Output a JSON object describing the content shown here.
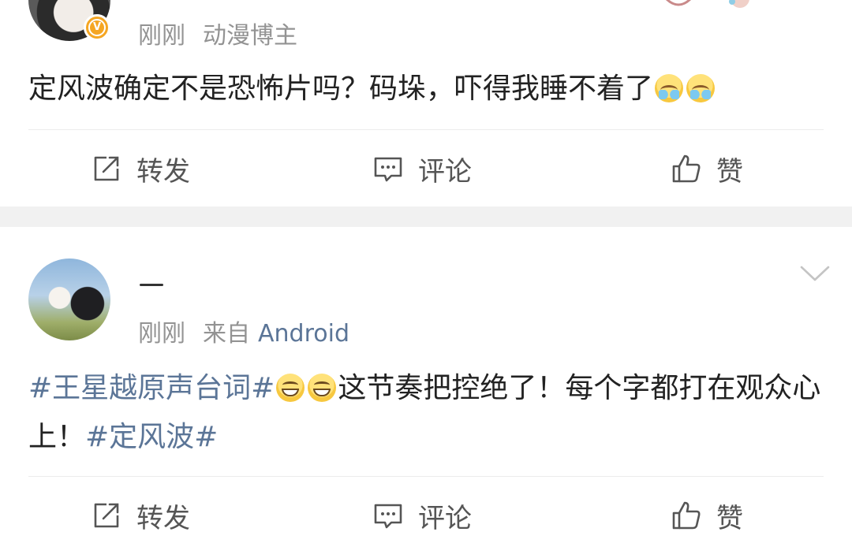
{
  "posts": [
    {
      "time": "刚刚",
      "source": "动漫博主",
      "verified": true,
      "content_text": "定风波确定不是恐怖片吗？码垛，吓得我睡不着了",
      "trailing_emojis": [
        "cry-emoji",
        "cry-emoji"
      ],
      "actions": {
        "repost_label": "转发",
        "comment_label": "评论",
        "like_label": "赞"
      }
    },
    {
      "time": "刚刚",
      "source_prefix": "来自",
      "source": "Android",
      "content": {
        "hashtag_1": "#王星越原声台词#",
        "emojis": [
          "grin-emoji",
          "grin-emoji"
        ],
        "text": "这节奏把控绝了！每个字都打在观众心上！",
        "hashtag_2": "#定风波#"
      },
      "actions": {
        "repost_label": "转发",
        "comment_label": "评论",
        "like_label": "赞"
      }
    }
  ],
  "icons": {
    "repost": "repost-icon",
    "comment": "comment-icon",
    "like": "thumbs-up-icon",
    "more": "chevron-down-icon",
    "verified": "verified-badge-icon"
  },
  "colors": {
    "hashtag": "#5b7597",
    "meta": "#939393",
    "verified_badge": "#f5a623",
    "separator": "#f1f1f1"
  }
}
